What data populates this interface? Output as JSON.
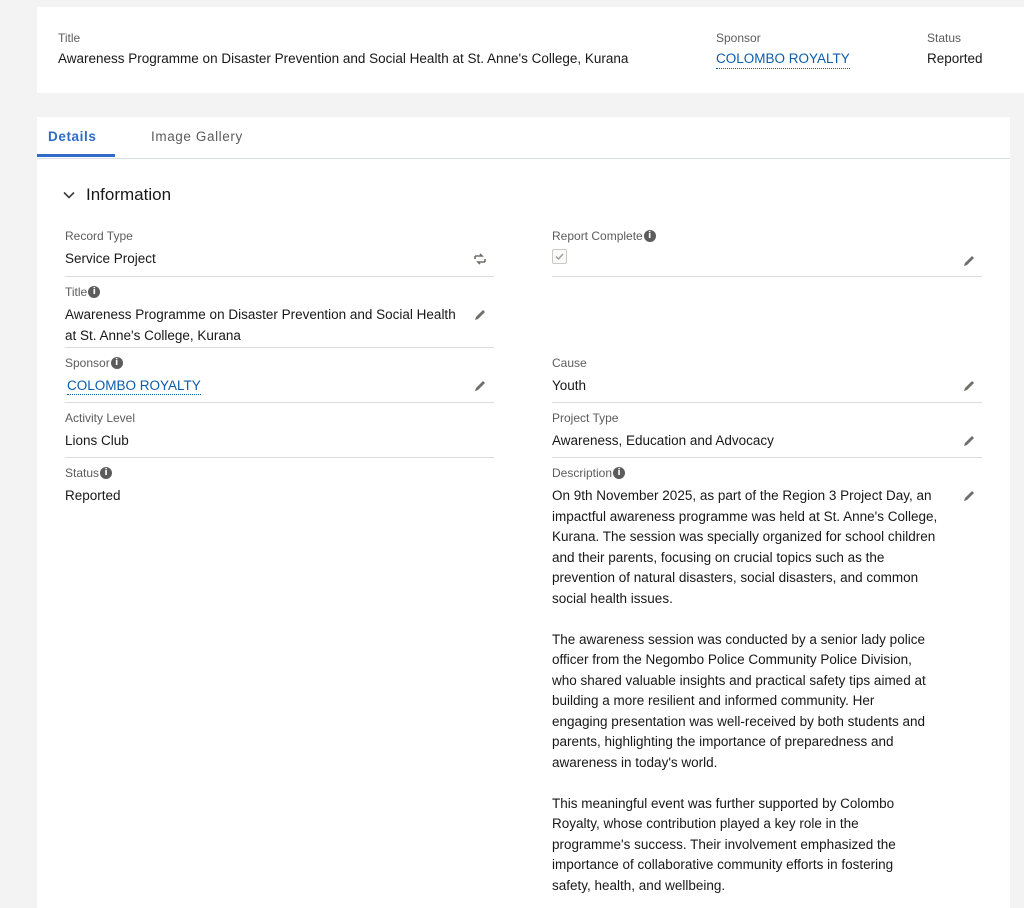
{
  "header": {
    "title_label": "Title",
    "title_value": "Awareness Programme on Disaster Prevention and Social Health at St. Anne's College, Kurana",
    "sponsor_label": "Sponsor",
    "sponsor_value": "COLOMBO ROYALTY",
    "status_label": "Status",
    "status_value": "Reported"
  },
  "tabs": [
    {
      "label": "Details",
      "active": true
    },
    {
      "label": "Image Gallery",
      "active": false
    }
  ],
  "section": {
    "title": "Information"
  },
  "fields": {
    "record_type": {
      "label": "Record Type",
      "value": "Service Project"
    },
    "report_complete": {
      "label": "Report Complete",
      "checked": true
    },
    "title": {
      "label": "Title",
      "value_line1": "Awareness Programme on Disaster Prevention and Social Health",
      "value_line2": "at St. Anne's College, Kurana"
    },
    "sponsor": {
      "label": "Sponsor",
      "value": "COLOMBO ROYALTY"
    },
    "cause": {
      "label": "Cause",
      "value": "Youth"
    },
    "activity_level": {
      "label": "Activity Level",
      "value": "Lions Club"
    },
    "project_type": {
      "label": "Project Type",
      "value": "Awareness, Education and Advocacy"
    },
    "status": {
      "label": "Status",
      "value": "Reported"
    },
    "description": {
      "label": "Description",
      "paragraphs": [
        [
          "On 9th November 2025, as part of the Region 3 Project Day, an",
          "impactful awareness programme was held at St. Anne's College,",
          "Kurana. The session was specially organized for school children",
          "and their parents, focusing on crucial topics such as the",
          "prevention of natural disasters, social disasters, and common",
          "social health issues."
        ],
        [
          "The awareness session was conducted by a senior lady police",
          "officer from the Negombo Police Community Police Division,",
          "who shared valuable insights and practical safety tips aimed at",
          "building a more resilient and informed community. Her",
          "engaging presentation was well-received by both students and",
          "parents, highlighting the importance of preparedness and",
          "awareness in today's world."
        ],
        [
          "This meaningful event was further supported by Colombo",
          "Royalty, whose contribution played a key role in the",
          "programme's success. Their involvement emphasized the",
          "importance of collaborative community efforts in fostering",
          "safety, health, and wellbeing."
        ]
      ]
    }
  },
  "colors": {
    "accent": "#2e6bc6",
    "link": "#0b5cab",
    "background": "#f3f3f3"
  },
  "icons": [
    "chevron-down-icon",
    "info-icon",
    "edit-pencil-icon",
    "change-record-type-icon",
    "checkmark-icon"
  ]
}
